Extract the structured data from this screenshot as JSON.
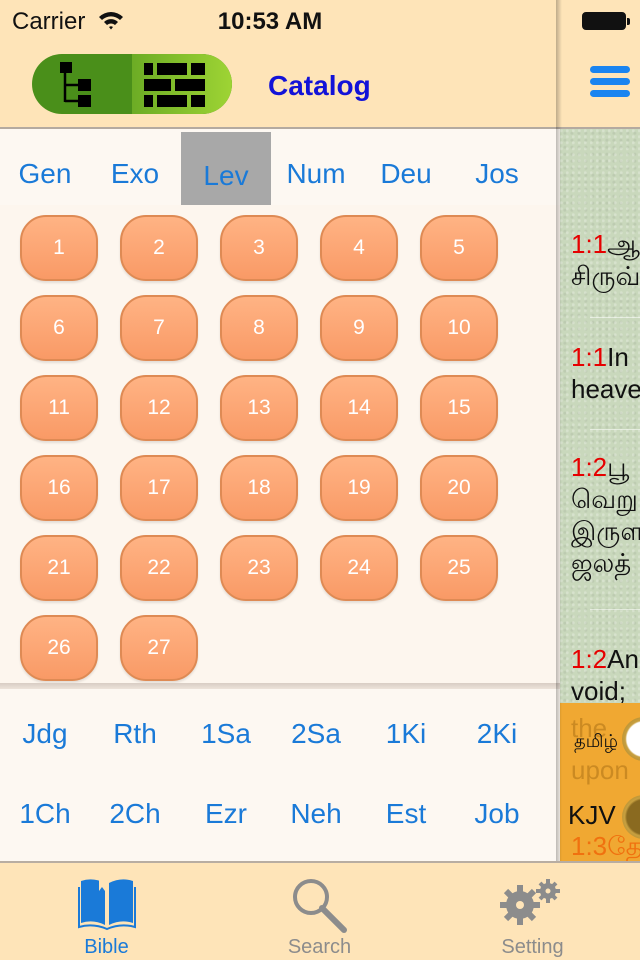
{
  "status_bar": {
    "carrier": "Carrier",
    "time": "10:53 AM"
  },
  "navbar": {
    "title": "Catalog",
    "view_toggle": {
      "options": [
        "tree-view",
        "grid-view"
      ],
      "selected": "grid-view"
    },
    "menu_icon": "hamburger-menu-icon"
  },
  "books_top": {
    "items": [
      "Gen",
      "Exo",
      "Lev",
      "Num",
      "Deu",
      "Jos"
    ],
    "selected": "Lev"
  },
  "chapters": [
    "1",
    "2",
    "3",
    "4",
    "5",
    "6",
    "7",
    "8",
    "9",
    "10",
    "11",
    "12",
    "13",
    "14",
    "15",
    "16",
    "17",
    "18",
    "19",
    "20",
    "21",
    "22",
    "23",
    "24",
    "25",
    "26",
    "27"
  ],
  "books_lower": {
    "rows": [
      [
        "Jdg",
        "Rth",
        "1Sa",
        "2Sa",
        "1Ki",
        "2Ki"
      ],
      [
        "1Ch",
        "2Ch",
        "Ezr",
        "Neh",
        "Est",
        "Job"
      ]
    ]
  },
  "reader_panel": {
    "verses": [
      {
        "num": "1:1",
        "lines": [
          "ஆ",
          "சிருவ்"
        ]
      },
      {
        "num": "1:1",
        "lines": [
          "In",
          "heave"
        ]
      },
      {
        "num": "1:2",
        "lines": [
          "பூ",
          "வெறு",
          "இருள",
          "ஜலத்"
        ]
      },
      {
        "num": "1:2",
        "lines": [
          "An",
          "void;"
        ]
      }
    ],
    "language_switcher": {
      "options": [
        {
          "label": "தமிழ்",
          "on": true
        },
        {
          "label": "KJV",
          "on": false
        }
      ],
      "ghost_text": [
        "the",
        "upon",
        "1:3தே"
      ]
    }
  },
  "tabbar": {
    "tabs": [
      {
        "label": "Bible",
        "icon": "open-book-icon",
        "active": true
      },
      {
        "label": "Search",
        "icon": "magnifier-icon",
        "active": false
      },
      {
        "label": "Setting",
        "icon": "gears-icon",
        "active": false
      }
    ]
  },
  "colors": {
    "accent_blue": "#1a7ad8",
    "title_blue": "#1212d8",
    "chapter_orange": "#f99a66",
    "verse_number_red": "#e60000",
    "inactive_gray": "#8c8c8c",
    "bar_background": "#fee4b8"
  }
}
